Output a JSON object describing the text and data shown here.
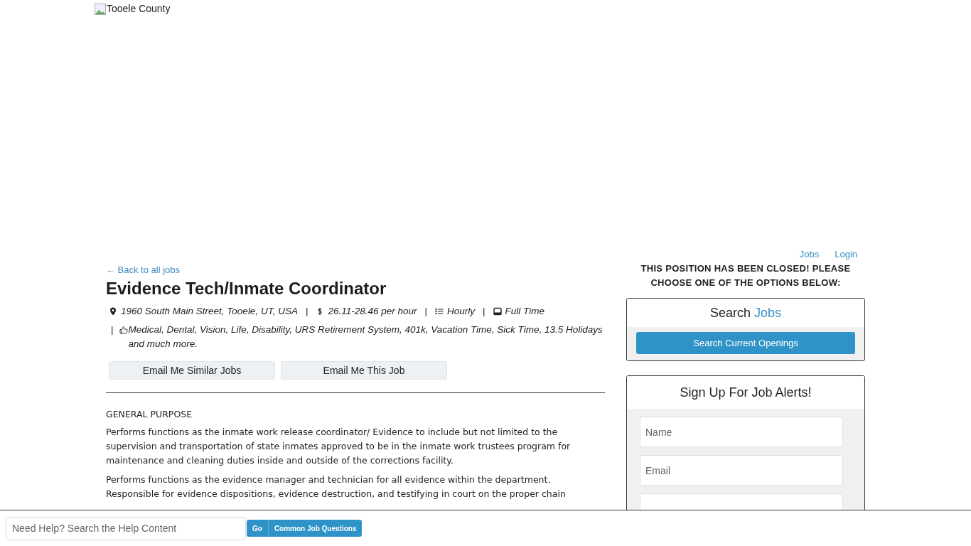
{
  "header": {
    "logo_alt": "Tooele County"
  },
  "nav": [
    {
      "label": "Jobs"
    },
    {
      "label": "Login"
    }
  ],
  "job": {
    "back_link": "← Back to all jobs",
    "title": "Evidence Tech/Inmate Coordinator",
    "meta": [
      {
        "kind": "location",
        "text": "1960 South Main Street, Tooele, UT, USA"
      },
      {
        "kind": "pay",
        "text": "26.11-28.46 per hour"
      },
      {
        "kind": "pay_type",
        "text": "Hourly"
      },
      {
        "kind": "schedule",
        "text": "Full Time"
      },
      {
        "kind": "benefits",
        "text": "Medical, Dental, Vision, Life, Disability, URS Retirement System, 401k, Vacation Time, Sick Time, 13.5 Holidays and much more."
      }
    ],
    "separator": "|",
    "buttons": [
      "Email Me Similar Jobs",
      "Email Me This Job"
    ],
    "section_heading": "GENERAL PURPOSE",
    "paragraphs": [
      "Performs functions as the inmate work release coordinator/ Evidence to include but not limited to the supervision and transportation of state inmates approved to be in the inmate work trustees program for maintenance and cleaning duties inside and outside of the corrections facility.",
      "Performs functions as the evidence manager and technician for all evidence within the department. Responsible for evidence dispositions, evidence destruction, and testifying in court on the proper chain"
    ]
  },
  "sidebar": {
    "closed_notice": "THIS POSITION HAS BEEN CLOSED! PLEASE CHOOSE ONE OF THE OPTIONS BELOW:",
    "search_card": {
      "title": "Search",
      "title_link": "Jobs",
      "button": "Search Current Openings"
    },
    "alerts_card": {
      "title": "Sign Up For Job Alerts!",
      "fields": [
        {
          "placeholder": "Name"
        },
        {
          "placeholder": "Email"
        }
      ]
    }
  },
  "help_bar": {
    "search": {
      "placeholder": "Need Help? Search the Help Content"
    },
    "go_button": "Go",
    "questions_button": "Common Job Questions"
  }
}
